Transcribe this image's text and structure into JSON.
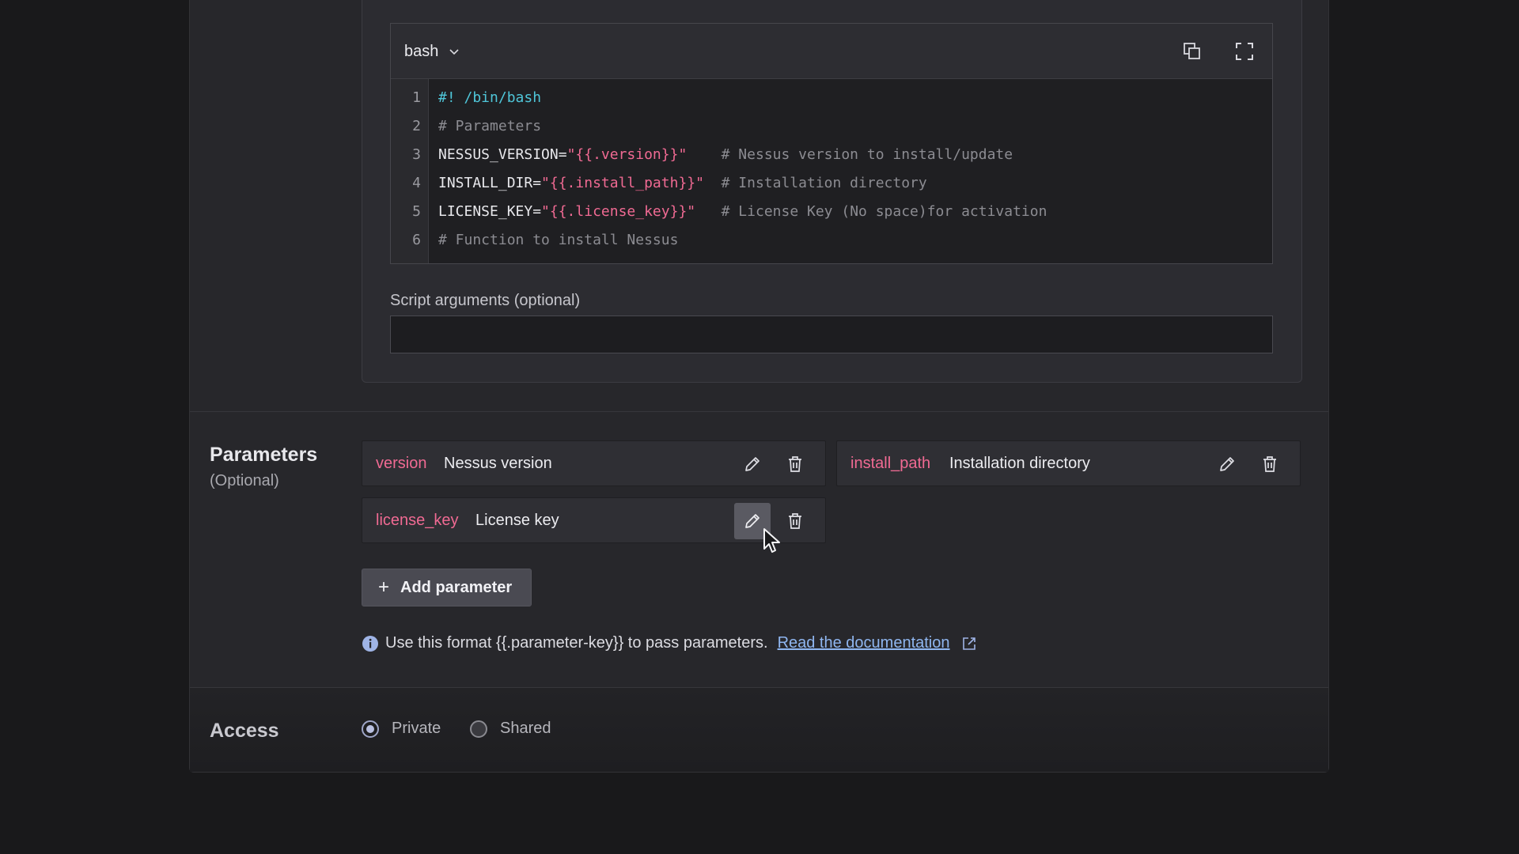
{
  "editor": {
    "language": "bash",
    "lines": [
      {
        "num": "1",
        "segments": [
          {
            "cls": "c-shebang",
            "text": "#! /bin/bash"
          }
        ]
      },
      {
        "num": "2",
        "segments": [
          {
            "cls": "c-comment",
            "text": "# Parameters"
          }
        ]
      },
      {
        "num": "3",
        "segments": [
          {
            "cls": "c-plain",
            "text": "NESSUS_VERSION="
          },
          {
            "cls": "c-str",
            "text": "\"{{.version}}\""
          },
          {
            "cls": "c-comment",
            "text": "    # Nessus version to install/update"
          }
        ]
      },
      {
        "num": "4",
        "segments": [
          {
            "cls": "c-plain",
            "text": "INSTALL_DIR="
          },
          {
            "cls": "c-str",
            "text": "\"{{.install_path}}\""
          },
          {
            "cls": "c-comment",
            "text": "  # Installation directory"
          }
        ]
      },
      {
        "num": "5",
        "segments": [
          {
            "cls": "c-plain",
            "text": "LICENSE_KEY="
          },
          {
            "cls": "c-str",
            "text": "\"{{.license_key}}\""
          },
          {
            "cls": "c-comment",
            "text": "   # License Key (No space)for activation"
          }
        ]
      },
      {
        "num": "6",
        "segments": [
          {
            "cls": "c-comment",
            "text": "# Function to install Nessus"
          }
        ]
      }
    ]
  },
  "script_arguments": {
    "label": "Script arguments (optional)",
    "value": ""
  },
  "parameters": {
    "title": "Parameters",
    "subtitle": "(Optional)",
    "items": [
      {
        "key": "version",
        "description": "Nessus version"
      },
      {
        "key": "install_path",
        "description": "Installation directory"
      },
      {
        "key": "license_key",
        "description": "License key"
      }
    ],
    "add_label": "Add parameter",
    "info_text": "Use this format {{.parameter-key}} to pass parameters.",
    "doc_link": "Read the documentation"
  },
  "access": {
    "title": "Access",
    "options": [
      {
        "label": "Private",
        "selected": true
      },
      {
        "label": "Shared",
        "selected": false
      }
    ]
  },
  "colors": {
    "accent_key": "#f06a93",
    "link": "#8fb6f0",
    "shebang": "#4fc6d9"
  },
  "icons": [
    "chevron-down-icon",
    "copy-icon",
    "fullscreen-icon",
    "pencil-icon",
    "trash-icon",
    "plus-icon",
    "info-icon",
    "external-link-icon",
    "cursor-arrow-icon"
  ]
}
